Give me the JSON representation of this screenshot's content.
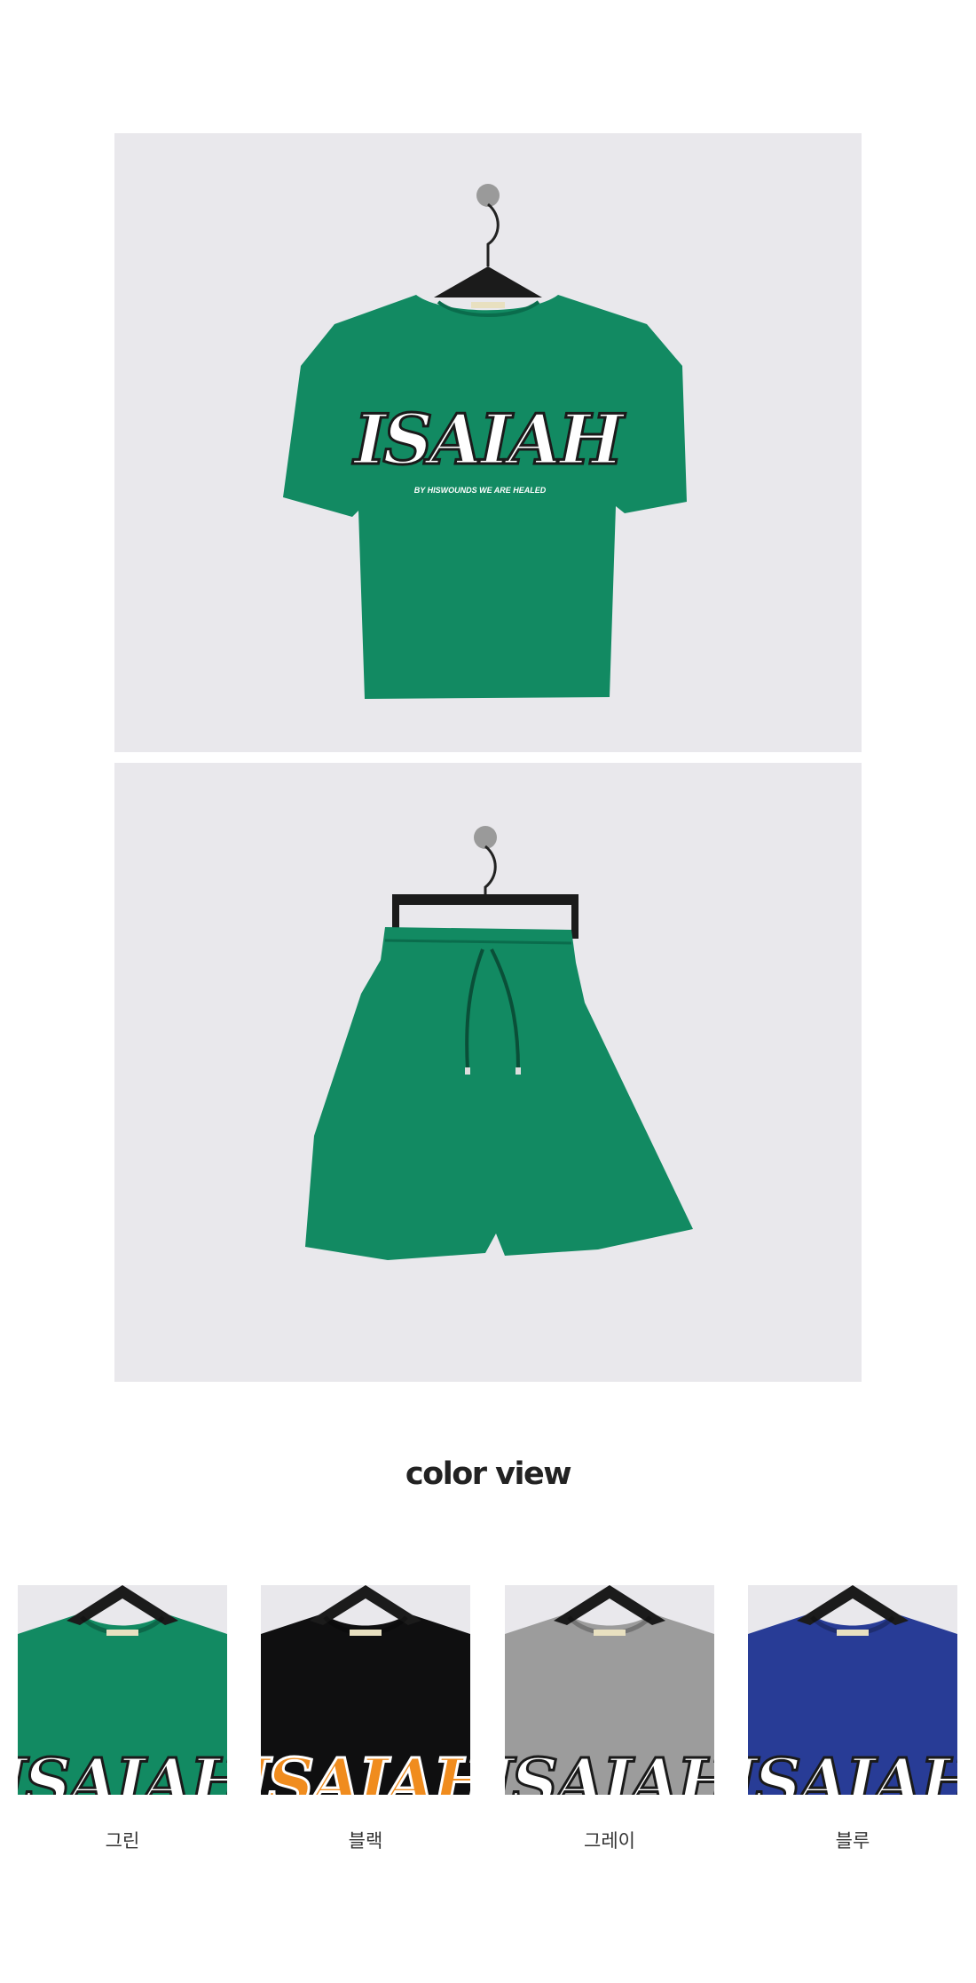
{
  "tee_print": {
    "logo_text": "ISAIAH",
    "tagline": "BY HISWOUNDS WE ARE HEALED"
  },
  "colors": {
    "studio_background": "#e9e8ec",
    "green": "#128a62",
    "black": "#0f0f10",
    "gray": "#9c9c9c",
    "blue": "#283c96",
    "orange_print": "#f08c1e"
  },
  "color_view": {
    "heading": "color view",
    "swatches": [
      {
        "label": "그린",
        "garment_color": "#128a62",
        "print_fill": "#ffffff",
        "print_outline": "#1a1a1a"
      },
      {
        "label": "블랙",
        "garment_color": "#0f0f10",
        "print_fill": "#f08c1e",
        "print_outline": "#ffffff"
      },
      {
        "label": "그레이",
        "garment_color": "#9c9c9c",
        "print_fill": "#ffffff",
        "print_outline": "#1a1a1a"
      },
      {
        "label": "블루",
        "garment_color": "#283c96",
        "print_fill": "#ffffff",
        "print_outline": "#1a1a1a"
      }
    ]
  }
}
